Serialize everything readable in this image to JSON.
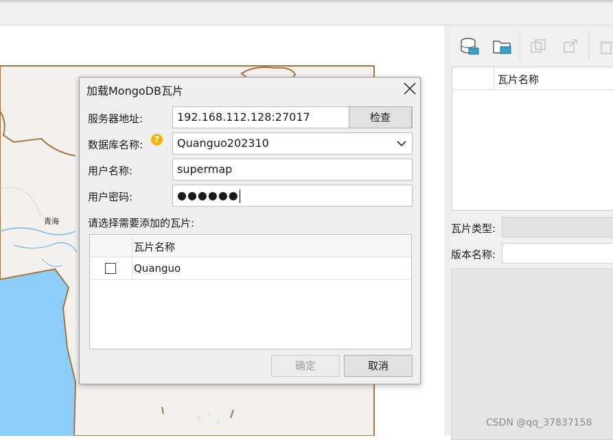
{
  "dialog": {
    "title": "加载MongoDB瓦片",
    "server_label": "服务器地址:",
    "server_value": "192.168.112.128:27017",
    "check_label": "检查",
    "db_label": "数据库名称:",
    "db_value": "Quanguo202310",
    "user_label": "用户名称:",
    "user_value": "supermap",
    "password_label": "用户密码:",
    "password_value": "●●●●●●",
    "select_prompt": "请选择需要添加的瓦片:",
    "grid": {
      "header": "瓦片名称",
      "rows": [
        {
          "name": "Quanguo",
          "checked": false
        }
      ]
    },
    "ok_label": "确定",
    "cancel_label": "取消"
  },
  "map": {
    "label": "青海"
  },
  "right_panel": {
    "grid_header": "瓦片名称",
    "tile_type_label": "瓦片类型:",
    "version_label": "版本名称:"
  },
  "watermark": "CSDN @qq_37837158",
  "colors": {
    "water": "#8ecdf7",
    "land": "#f2f1ee",
    "border": "#a8743e",
    "river": "#6bb8ea"
  }
}
